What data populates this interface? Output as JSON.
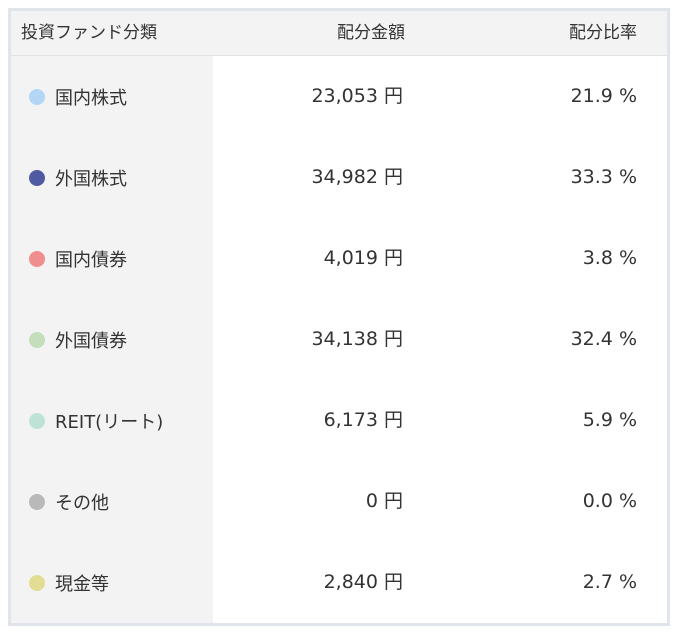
{
  "header": {
    "category_label": "投資ファンド分類",
    "amount_label": "配分金額",
    "ratio_label": "配分比率"
  },
  "rows": [
    {
      "name": "国内株式",
      "amount": "23,053 円",
      "ratio": "21.9 %",
      "color": "#b3d6f7"
    },
    {
      "name": "外国株式",
      "amount": "34,982 円",
      "ratio": "33.3 %",
      "color": "#4f5aa0"
    },
    {
      "name": "国内債券",
      "amount": "4,019 円",
      "ratio": "3.8 %",
      "color": "#f08e8e"
    },
    {
      "name": "外国債券",
      "amount": "34,138 円",
      "ratio": "32.4 %",
      "color": "#c4ddba"
    },
    {
      "name": "REIT(リート)",
      "amount": "6,173 円",
      "ratio": "5.9 %",
      "color": "#bde3d6"
    },
    {
      "name": "その他",
      "amount": "0 円",
      "ratio": "0.0 %",
      "color": "#b9b9b9"
    },
    {
      "name": "現金等",
      "amount": "2,840 円",
      "ratio": "2.7 %",
      "color": "#e3dc93"
    }
  ]
}
